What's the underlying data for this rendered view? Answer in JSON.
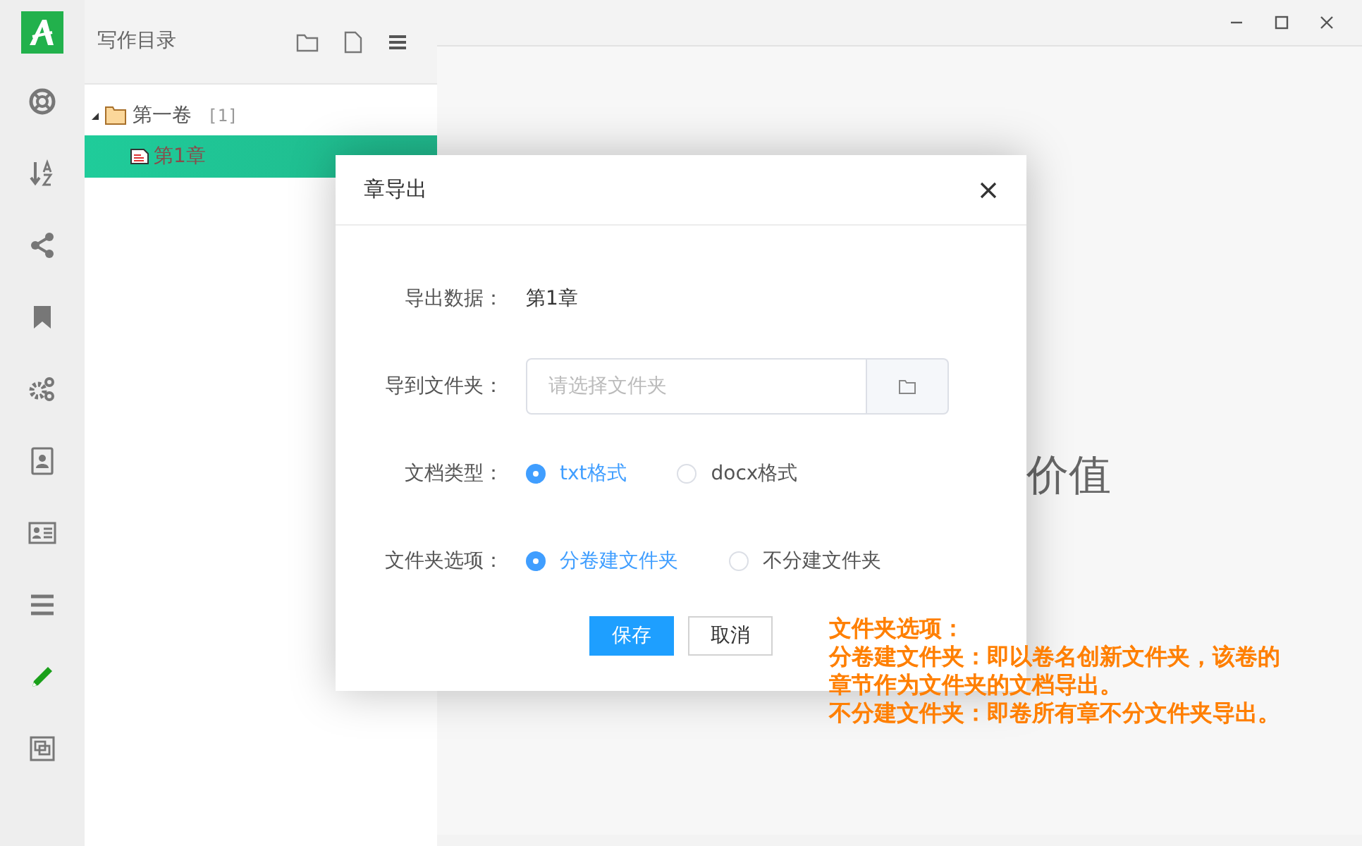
{
  "sidebar": {
    "items": [
      {
        "kind": "lifebuoy",
        "selected": false
      },
      {
        "kind": "sort",
        "selected": false
      },
      {
        "kind": "share",
        "selected": false
      },
      {
        "kind": "bookmark",
        "selected": false
      },
      {
        "kind": "gears",
        "selected": false
      },
      {
        "kind": "contacts",
        "selected": false
      },
      {
        "kind": "card",
        "selected": false
      },
      {
        "kind": "list",
        "selected": false
      },
      {
        "kind": "pencil",
        "selected": true
      },
      {
        "kind": "frame",
        "selected": false
      }
    ]
  },
  "catalog": {
    "title": "写作目录",
    "tree": [
      {
        "label": "第一卷",
        "count": "[1]",
        "expanded": true,
        "children": [
          {
            "label": "第1章",
            "selected": true
          }
        ]
      }
    ]
  },
  "background_text": "价值",
  "dialog": {
    "title": "章导出",
    "fields": [
      {
        "kind": "text",
        "label": "导出数据：",
        "value": "第1章"
      },
      {
        "kind": "folder",
        "label": "导到文件夹：",
        "placeholder": "请选择文件夹"
      },
      {
        "kind": "radio",
        "label": "文档类型：",
        "options": [
          {
            "label": "txt格式",
            "selected": true
          },
          {
            "label": "docx格式",
            "selected": false
          }
        ]
      },
      {
        "kind": "radio",
        "label": "文件夹选项：",
        "options": [
          {
            "label": "分卷建文件夹",
            "selected": true
          },
          {
            "label": "不分建文件夹",
            "selected": false
          }
        ]
      }
    ],
    "buttons": [
      {
        "label": "保存",
        "primary": true
      },
      {
        "label": "取消",
        "primary": false
      }
    ]
  },
  "annotation": [
    "文件夹选项：",
    "分卷建文件夹：即以卷名创新文件夹，该卷的",
    "章节作为文件夹的文档导出。",
    "不分建文件夹：即卷所有章不分文件夹导出。"
  ]
}
